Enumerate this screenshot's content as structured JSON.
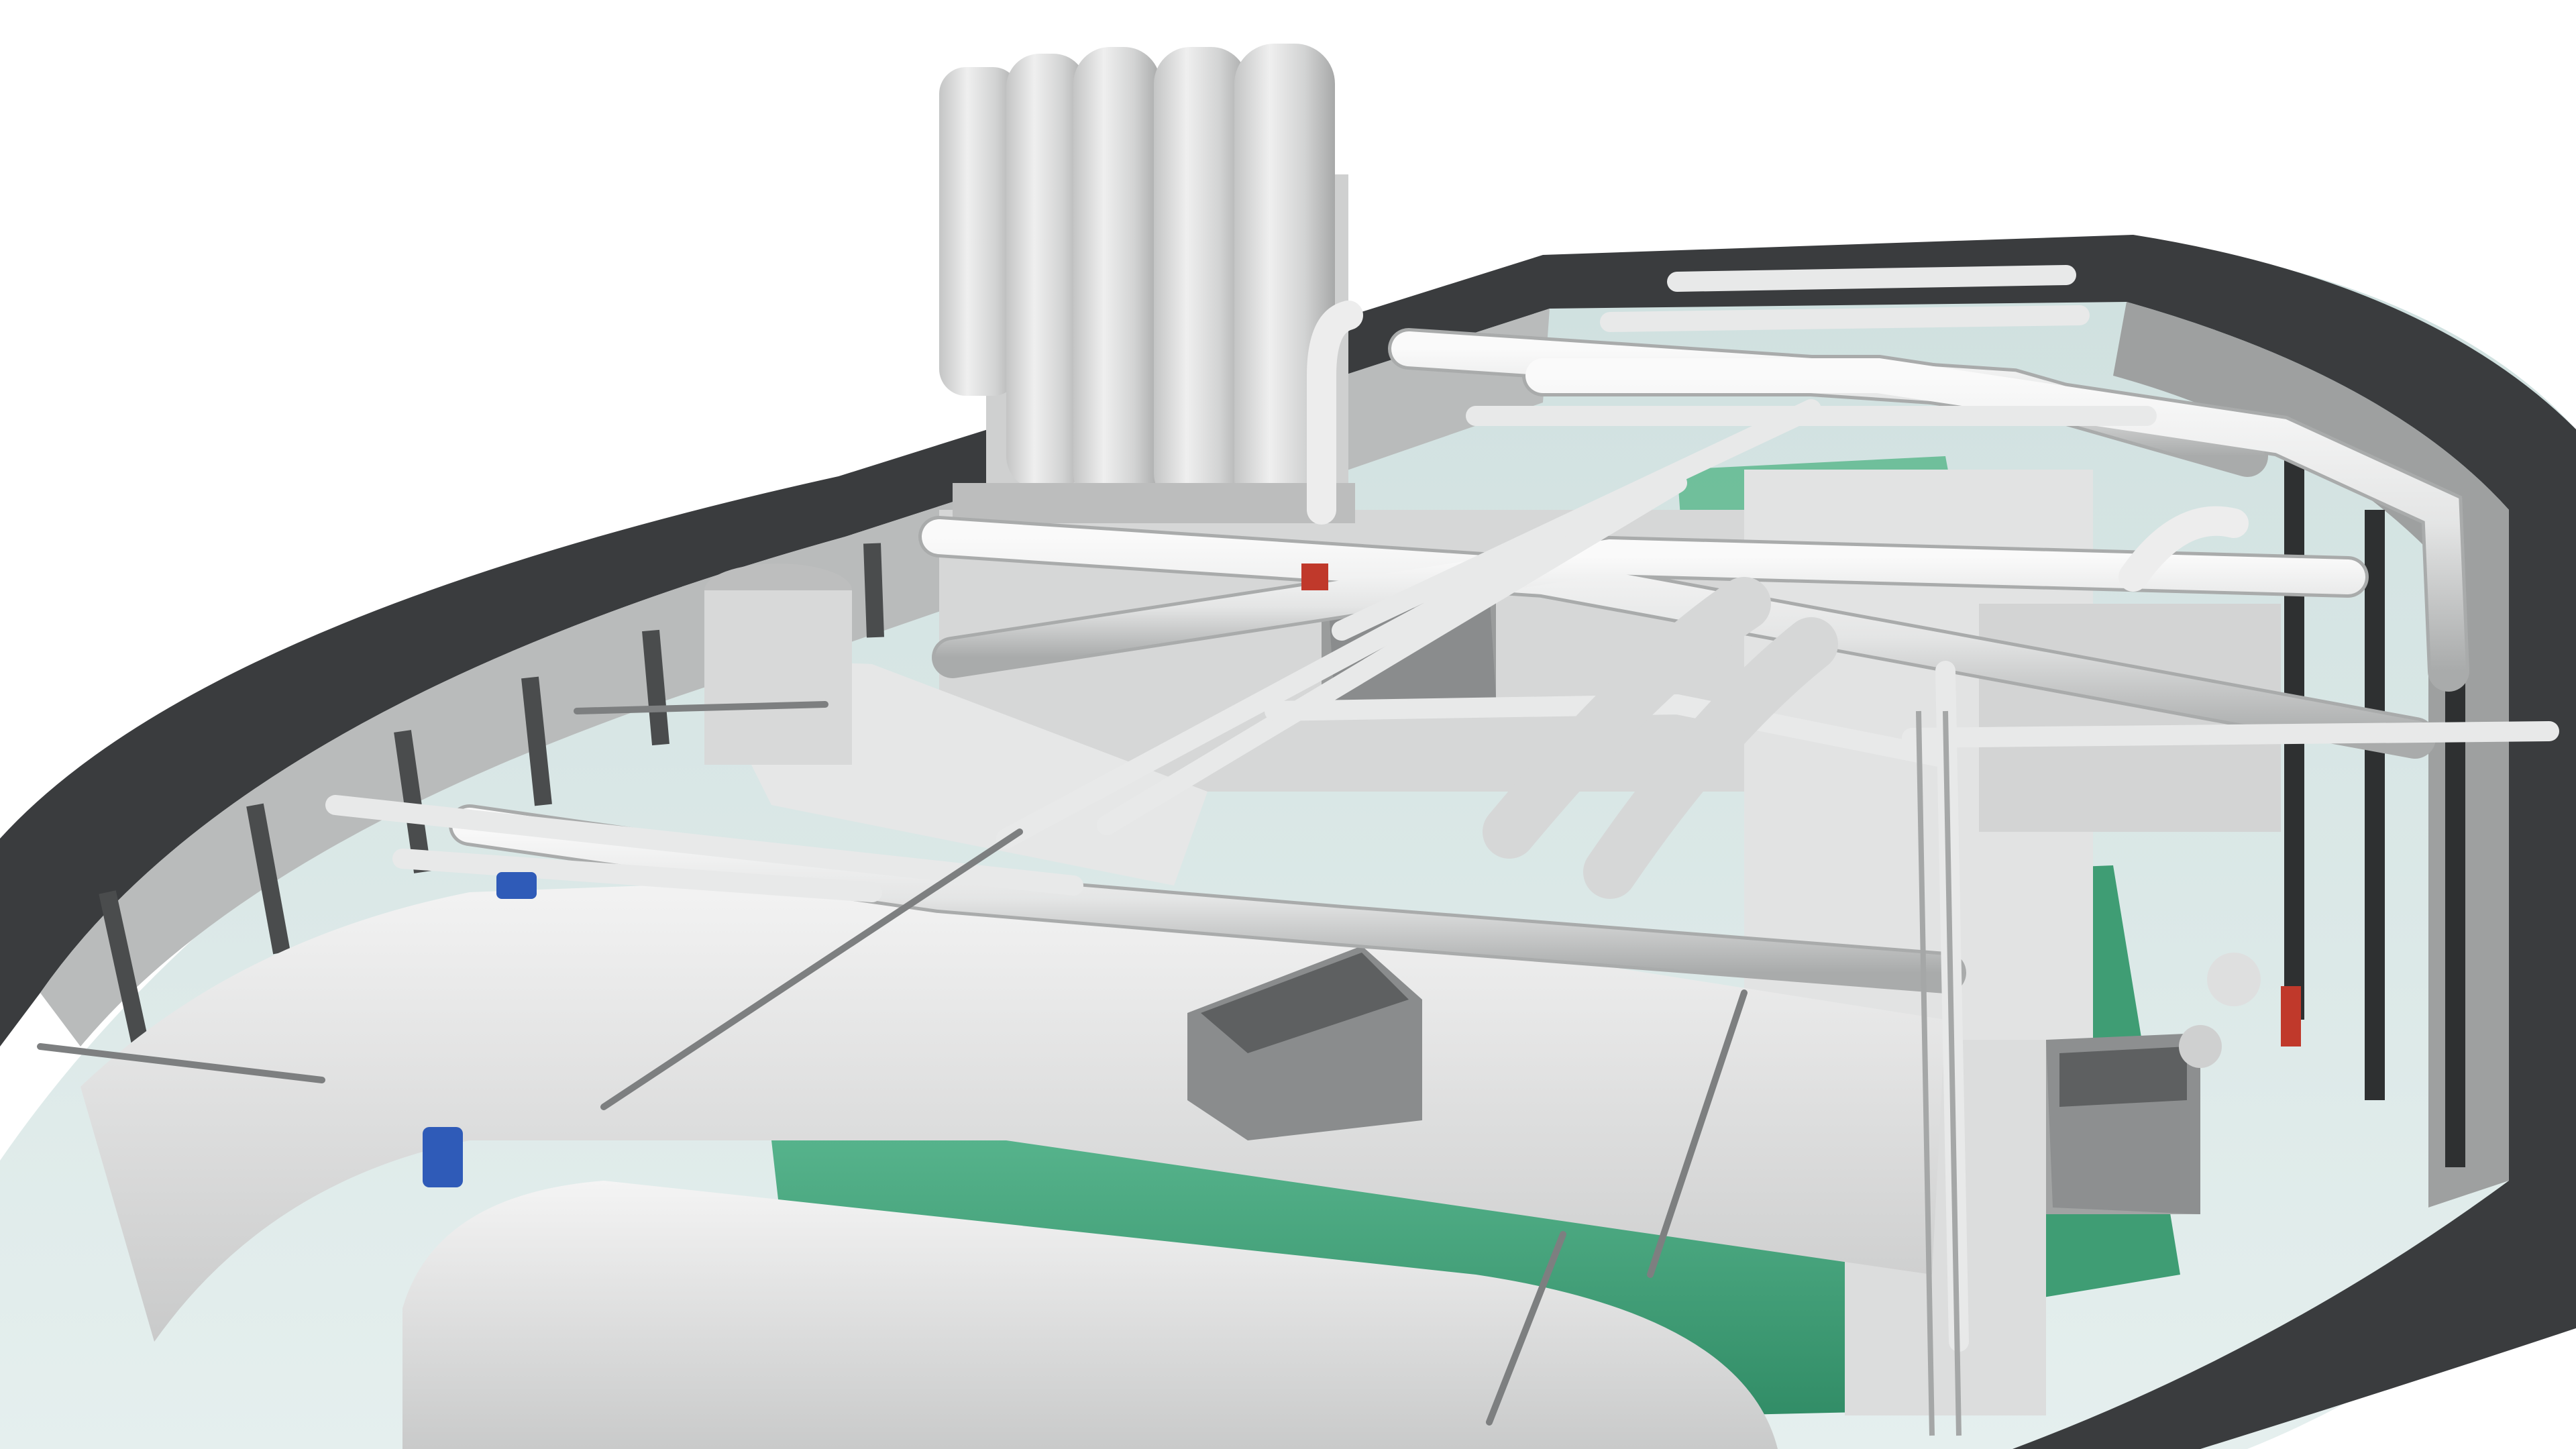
{
  "image": {
    "kind": "3d-render",
    "subject_icon": "ship-engine-room-cutaway",
    "colors": {
      "background": "#ffffff",
      "hull_dark": "#3b3d3f",
      "hull_light": "#c9d9d8",
      "wall_panel": "#b9bbbb",
      "pipe_white": "#e9eaea",
      "pipe_shadow": "#b8baba",
      "duct_white": "#ededed",
      "floor_green": "#4fae86",
      "grate_gray": "#8c8e8f",
      "exhaust_stack": "#d7d8d8",
      "pump_blue": "#2f5bb8",
      "valve_red": "#c0392b"
    }
  }
}
